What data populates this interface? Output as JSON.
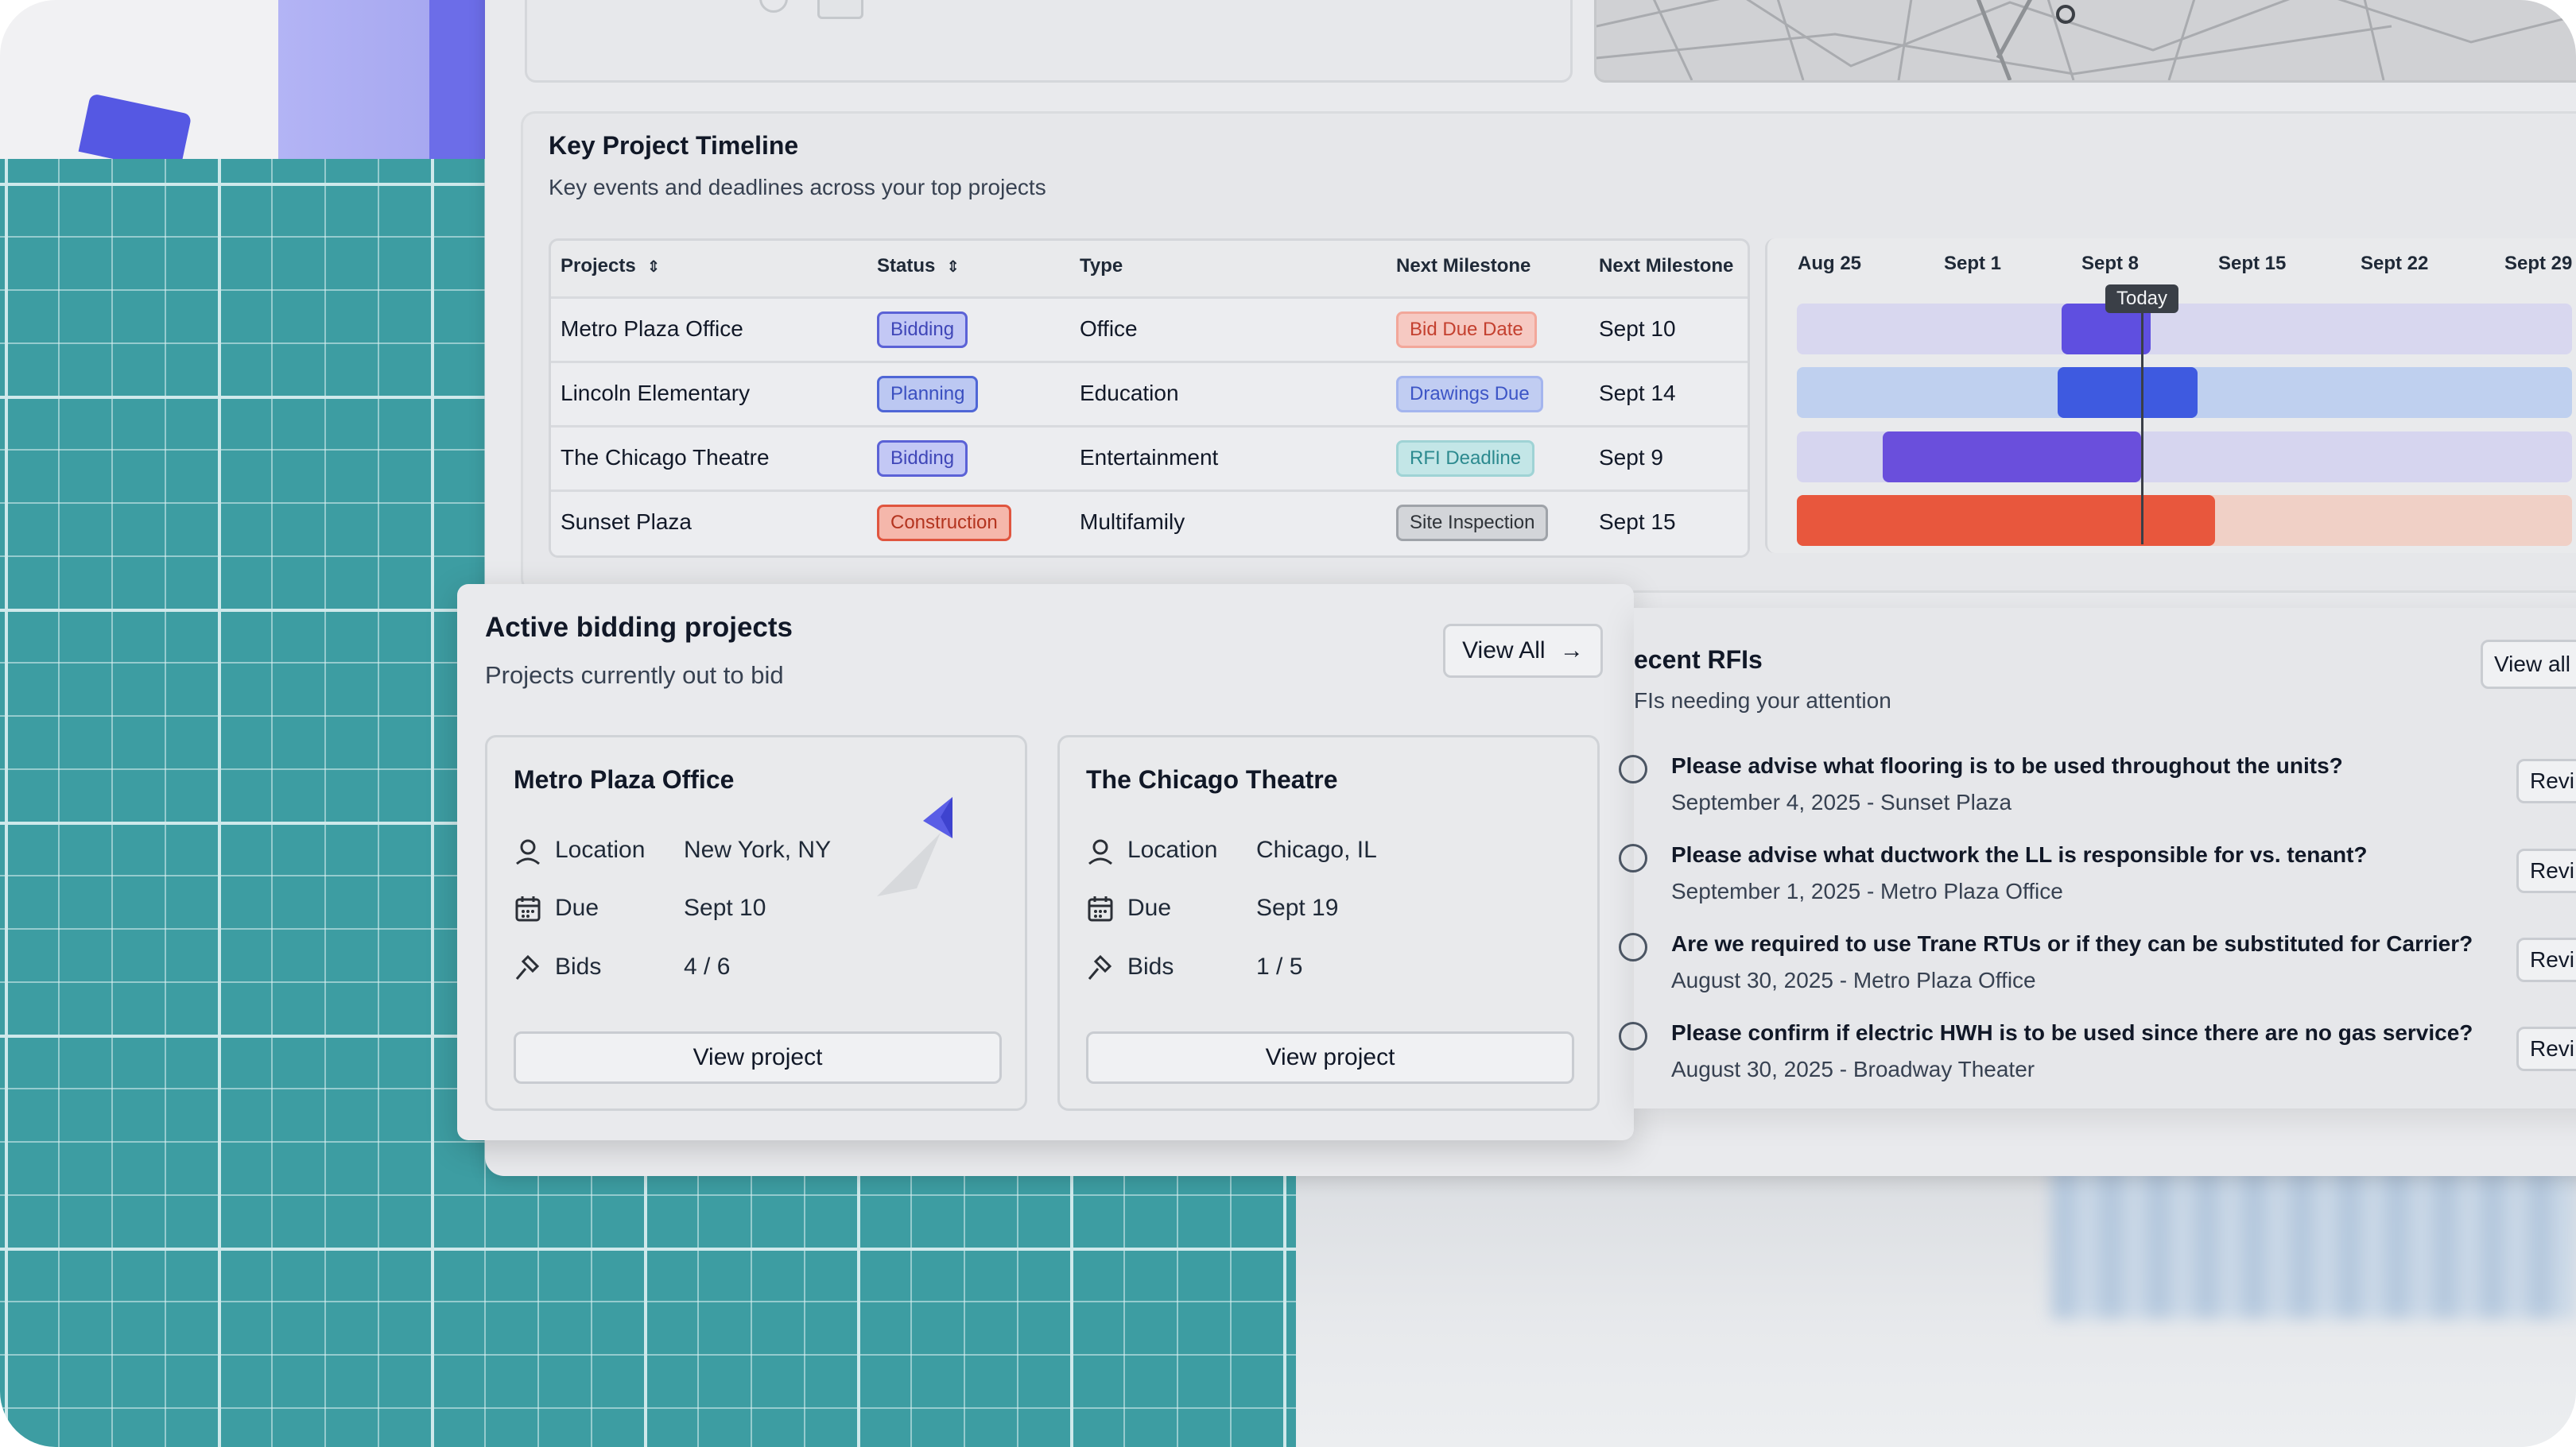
{
  "timeline": {
    "title": "Key Project Timeline",
    "subtitle": "Key events and deadlines across your top projects",
    "columns": [
      "Projects",
      "Status",
      "Type",
      "Next Milestone",
      "Next Milestone"
    ],
    "sort_icon": "sort-arrows-icon",
    "rows": [
      {
        "project": "Metro Plaza Office",
        "status": "Bidding",
        "type": "Office",
        "milestone": "Bid Due Date",
        "date": "Sept 10"
      },
      {
        "project": "Lincoln Elementary",
        "status": "Planning",
        "type": "Education",
        "milestone": "Drawings Due",
        "date": "Sept 14"
      },
      {
        "project": "The Chicago Theatre",
        "status": "Bidding",
        "type": "Entertainment",
        "milestone": "RFI Deadline",
        "date": "Sept 9"
      },
      {
        "project": "Sunset Plaza",
        "status": "Construction",
        "type": "Multifamily",
        "milestone": "Site Inspection",
        "date": "Sept 15"
      }
    ],
    "gantt_dates": [
      "Aug 25",
      "Sept 1",
      "Sept 8",
      "Sept 15",
      "Sept 22",
      "Sept 29"
    ],
    "today_label": "Today"
  },
  "bidding": {
    "title": "Active bidding projects",
    "subtitle": "Projects currently out to bid",
    "view_all": "View All",
    "labels": {
      "location": "Location",
      "due": "Due",
      "bids": "Bids"
    },
    "projects": [
      {
        "name": "Metro Plaza Office",
        "location": "New York, NY",
        "due": "Sept 10",
        "bids": "4 / 6",
        "button": "View project"
      },
      {
        "name": "The Chicago Theatre",
        "location": "Chicago, IL",
        "due": "Sept 19",
        "bids": "1 / 5",
        "button": "View project"
      }
    ]
  },
  "rfis": {
    "title": "ecent RFIs",
    "subtitle": "FIs needing your attention",
    "view_all": "View all",
    "review_label": "Revi",
    "items": [
      {
        "question": "Please advise what flooring is to be used throughout the units?",
        "meta": "September 4, 2025 - Sunset Plaza"
      },
      {
        "question": "Please advise what ductwork the LL is responsible for vs. tenant?",
        "meta": "September 1, 2025 - Metro Plaza Office"
      },
      {
        "question": "Are we required to use Trane RTUs or if they can be substituted for Carrier?",
        "meta": "August 30, 2025 - Metro Plaza Office"
      },
      {
        "question": "Please confirm if electric HWH is to be used since there are no gas service?",
        "meta": "August 30, 2025 - Broadway Theater"
      }
    ]
  },
  "colors": {
    "bidding": "#5b62d6",
    "planning": "#4f66d6",
    "construction": "#e0553f",
    "grid_teal": "#3d9da2"
  }
}
